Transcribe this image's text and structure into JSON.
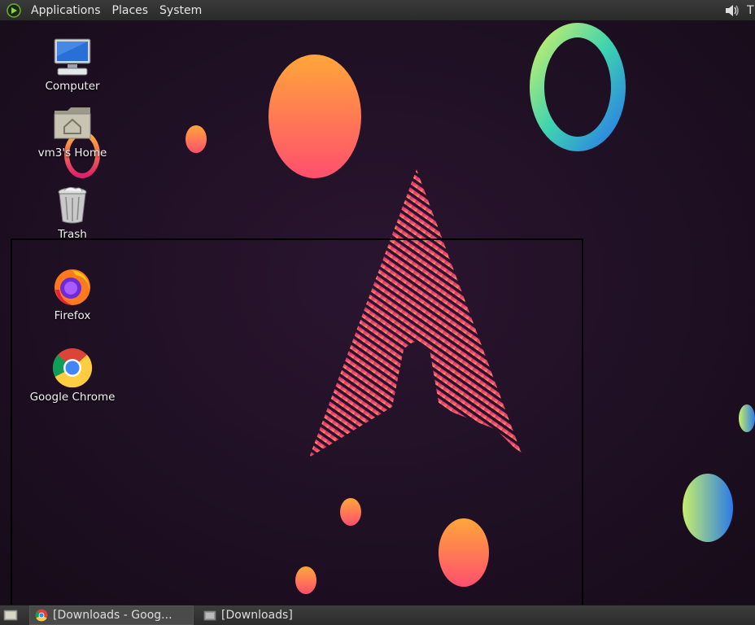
{
  "top_panel": {
    "menus": [
      "Applications",
      "Places",
      "System"
    ],
    "clock_partial": "T"
  },
  "desktop": {
    "icons": [
      {
        "label": "Computer",
        "icon": "computer-icon"
      },
      {
        "label": "vm3's Home",
        "icon": "home-folder-icon"
      },
      {
        "label": "Trash",
        "icon": "trash-icon"
      },
      {
        "label": "Firefox",
        "icon": "firefox-icon"
      },
      {
        "label": "Google Chrome",
        "icon": "chrome-icon"
      }
    ]
  },
  "taskbar": {
    "tasks": [
      {
        "label": "[Downloads - Goog...",
        "icon": "chrome-icon",
        "active": true
      },
      {
        "label": "[Downloads]",
        "icon": "file-manager-icon",
        "active": false
      }
    ]
  },
  "colors": {
    "background": "#1c1020",
    "accent_pink": "#e0206a",
    "accent_orange": "#ff9a3c"
  }
}
